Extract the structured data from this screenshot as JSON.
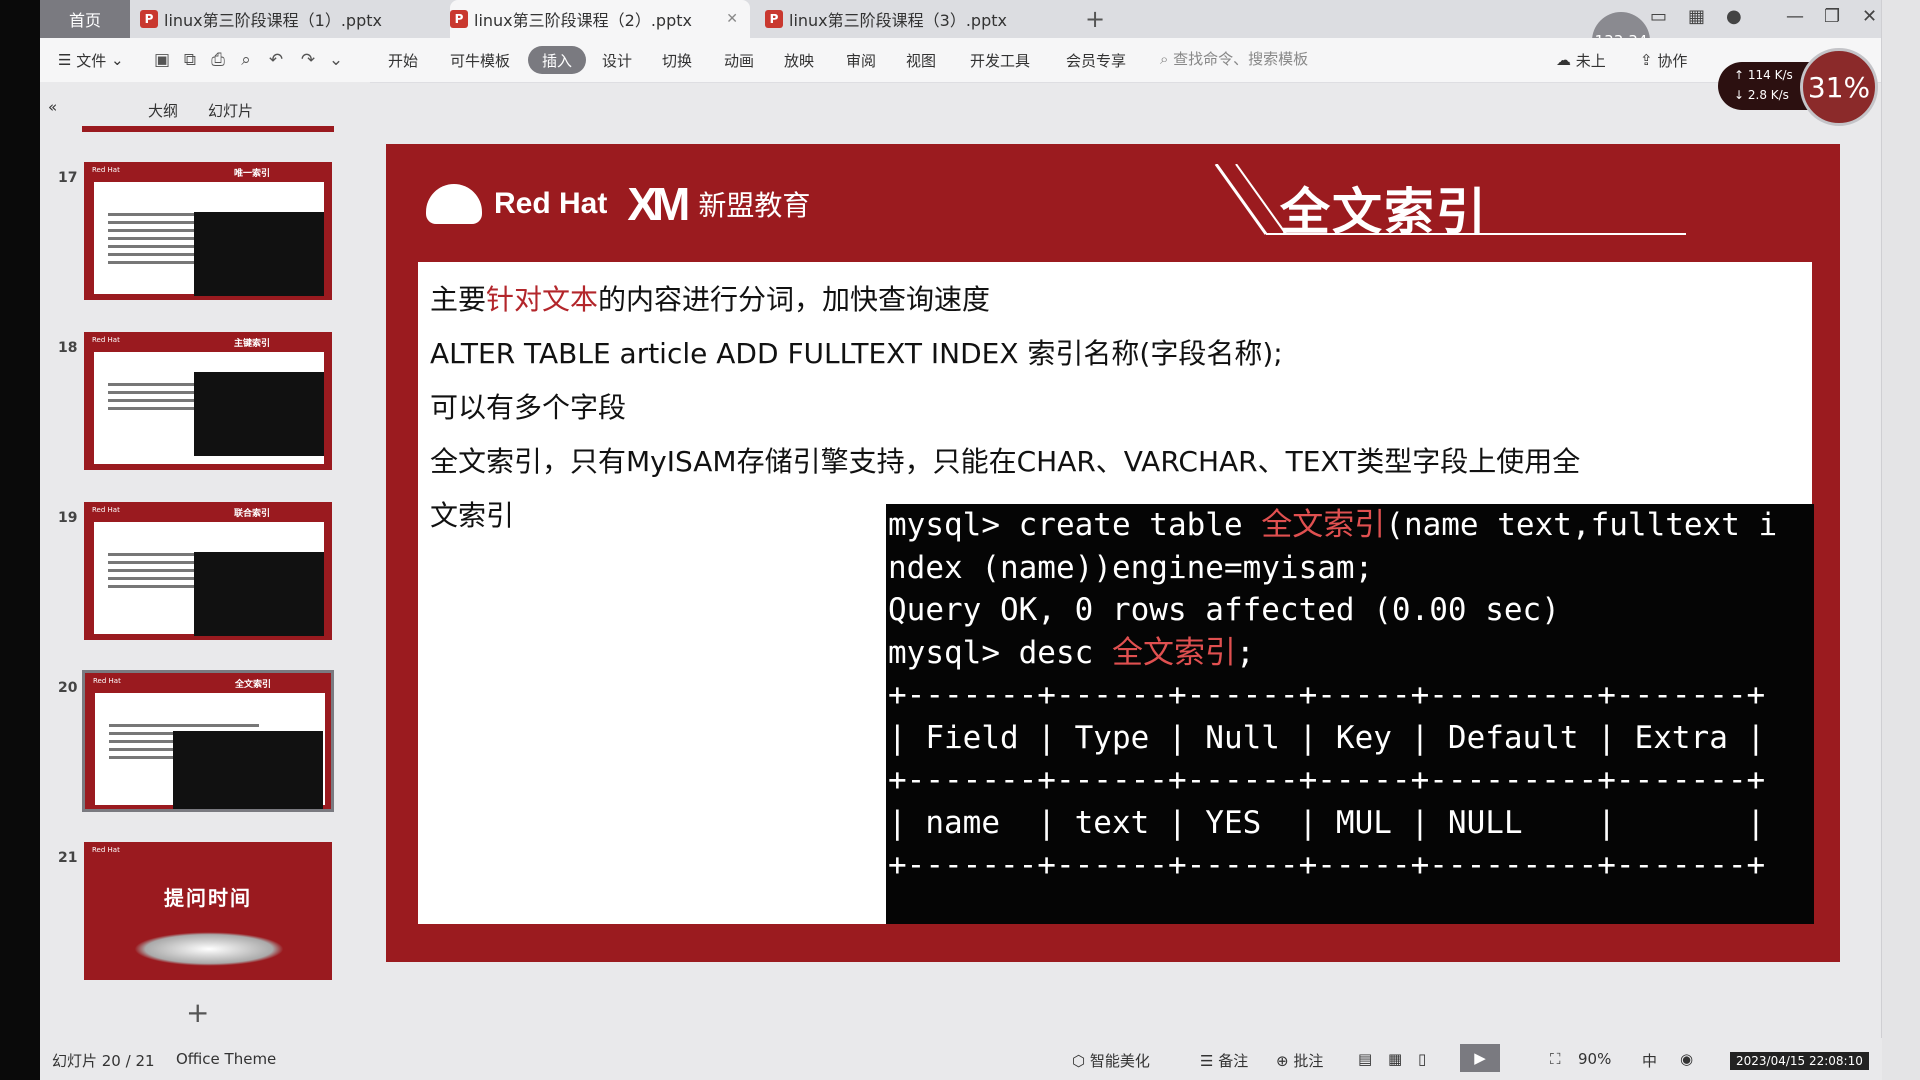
{
  "tabs": {
    "home": "首页",
    "items": [
      {
        "label": "linux第三阶段课程（1）.pptx"
      },
      {
        "label": "linux第三阶段课程（2）.pptx"
      },
      {
        "label": "linux第三阶段课程（3）.pptx"
      }
    ],
    "new_tab": "+",
    "timer": "133:34"
  },
  "ribbon": {
    "file": "文件",
    "menu": [
      "开始",
      "可牛模板",
      "插入",
      "设计",
      "切换",
      "动画",
      "放映",
      "审阅",
      "视图",
      "开发工具",
      "会员专享"
    ],
    "active": "插入",
    "search_placeholder": "查找命令、搜索模板",
    "sync": "未上",
    "collab": "协作"
  },
  "net": {
    "up": "↑ 114 K/s",
    "down": "↓ 2.8 K/s",
    "percent": "31%"
  },
  "pane": {
    "outline": "大纲",
    "slides": "幻灯片",
    "thumbnails": [
      {
        "num": "17",
        "title": "唯一索引"
      },
      {
        "num": "18",
        "title": "主键索引"
      },
      {
        "num": "19",
        "title": "联合索引"
      },
      {
        "num": "20",
        "title": "全文索引"
      },
      {
        "num": "21",
        "title": "提问时间"
      }
    ]
  },
  "status": {
    "slide_info": "幻灯片 20 / 21",
    "theme": "Office Theme",
    "beautify": "智能美化",
    "notes": "备注",
    "comment": "批注",
    "zoom": "90%",
    "ime": "中",
    "datetime": "2023/04/15 22:08:10"
  },
  "slide": {
    "brand": "Red Hat",
    "org": "新盟教育",
    "title": "全文索引",
    "line1_a": "主要",
    "line1_hl": "针对文本",
    "line1_b": "的内容进行分词，加快查询速度",
    "line2": "ALTER TABLE article ADD FULLTEXT INDEX 索引名称(字段名称);",
    "line3": "可以有多个字段",
    "line4": "全文索引，只有MyISAM存储引擎支持，只能在CHAR、VARCHAR、TEXT类型字段上使用全",
    "line5": "文索引",
    "terminal": {
      "l1a": "mysql> create table ",
      "l1red": "全文索引",
      "l1b": "(name text,fulltext i",
      "l2": "ndex (name))engine=myisam;",
      "l3": "Query OK, 0 rows affected (0.00 sec)",
      "l4": "",
      "l5a": "mysql> desc ",
      "l5red": "全文索引",
      "l5b": ";",
      "l6": "+-------+------+------+-----+---------+-------+",
      "l7": "| Field | Type | Null | Key | Default | Extra |",
      "l8": "+-------+------+------+-----+---------+-------+",
      "l9": "| name  | text | YES  | MUL | NULL    |       |",
      "l10": "+-------+------+------+-----+---------+-------+"
    }
  }
}
